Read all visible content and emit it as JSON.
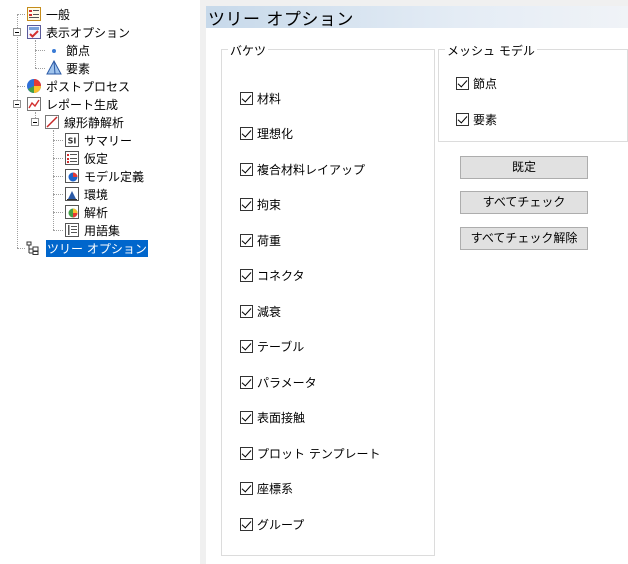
{
  "tree": {
    "items": [
      {
        "label": "一般",
        "icon": "general-settings-icon"
      },
      {
        "label": "表示オプション",
        "icon": "display-options-icon"
      },
      {
        "label": "節点",
        "icon": "node-dot-icon"
      },
      {
        "label": "要素",
        "icon": "element-tetra-icon"
      },
      {
        "label": "ポストプロセス",
        "icon": "post-process-icon"
      },
      {
        "label": "レポート生成",
        "icon": "report-icon"
      },
      {
        "label": "線形静解析",
        "icon": "linear-static-icon"
      },
      {
        "label": "サマリー",
        "icon": "summary-icon"
      },
      {
        "label": "仮定",
        "icon": "assumptions-icon"
      },
      {
        "label": "モデル定義",
        "icon": "model-definition-icon"
      },
      {
        "label": "環境",
        "icon": "environment-icon"
      },
      {
        "label": "解析",
        "icon": "analysis-icon"
      },
      {
        "label": "用語集",
        "icon": "glossary-icon"
      },
      {
        "label": "ツリー オプション",
        "icon": "tree-options-icon"
      }
    ]
  },
  "panel": {
    "title": "ツリー オプション",
    "buckets": {
      "legend": "バケツ",
      "items": [
        {
          "label": "材料",
          "checked": true
        },
        {
          "label": "理想化",
          "checked": true
        },
        {
          "label": "複合材料レイアップ",
          "checked": true
        },
        {
          "label": "拘束",
          "checked": true
        },
        {
          "label": "荷重",
          "checked": true
        },
        {
          "label": "コネクタ",
          "checked": true
        },
        {
          "label": "減衰",
          "checked": true
        },
        {
          "label": "テーブル",
          "checked": true
        },
        {
          "label": "パラメータ",
          "checked": true
        },
        {
          "label": "表面接触",
          "checked": true
        },
        {
          "label": "プロット テンプレート",
          "checked": true
        },
        {
          "label": "座標系",
          "checked": true
        },
        {
          "label": "グループ",
          "checked": true
        }
      ]
    },
    "mesh_model": {
      "legend": "メッシュ モデル",
      "items": [
        {
          "label": "節点",
          "checked": true
        },
        {
          "label": "要素",
          "checked": true
        }
      ]
    },
    "buttons": {
      "default": "既定",
      "check_all": "すべてチェック",
      "uncheck_all": "すべてチェック解除"
    }
  },
  "colors": {
    "selection": "#0066cc",
    "header_gradient_start": "#c7d9ea"
  }
}
